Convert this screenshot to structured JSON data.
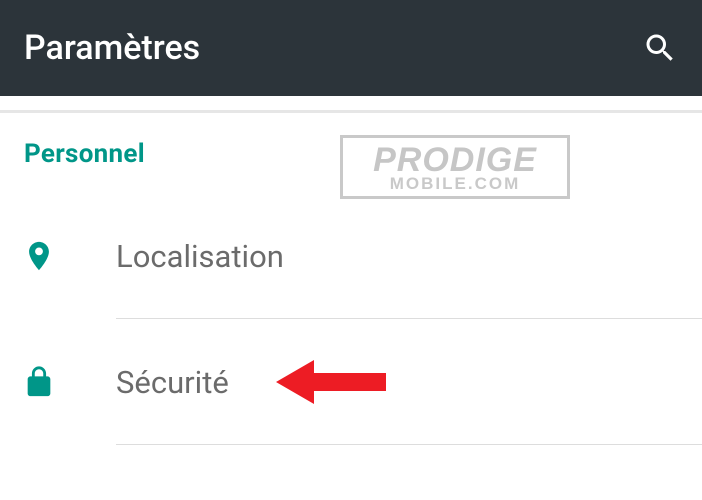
{
  "appBar": {
    "title": "Paramètres"
  },
  "section": {
    "title": "Personnel"
  },
  "watermark": {
    "line1": "PRODIGE",
    "line2": "MOBILE.COM"
  },
  "items": [
    {
      "label": "Localisation"
    },
    {
      "label": "Sécurité"
    }
  ],
  "colors": {
    "appBarBg": "#2c343a",
    "accent": "#009688",
    "arrow": "#ed1c24"
  }
}
